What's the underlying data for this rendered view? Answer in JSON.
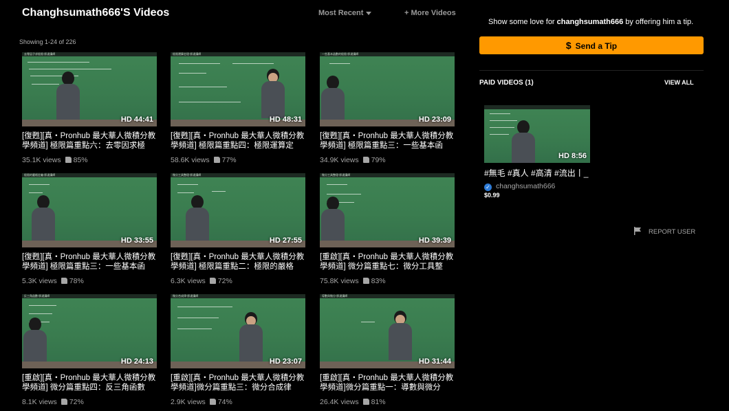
{
  "header": {
    "title": "Changhsumath666'S Videos",
    "sort_label": "Most Recent",
    "more_videos": "+ More Videos",
    "showing": "Showing 1-24 of 226"
  },
  "videos": [
    {
      "title": "[復甦][真・Pronhub 最大華人微積分教學頻道] 極限篇重點六：去零因求極",
      "views": "35.1K views",
      "rating": "85%",
      "duration": "HD 44:41",
      "caption": "去零因子求極限‧胖達講師"
    },
    {
      "title": "[復甦][真・Pronhub 最大華人微積分教學頻道] 極限篇重點四：極限運算定",
      "views": "58.6K views",
      "rating": "77%",
      "duration": "HD 48:31",
      "caption": "極限運算定理‧胖達講師"
    },
    {
      "title": "[復甦][真・Pronhub 最大華人微積分教學頻道] 極限篇重點三：一些基本函",
      "views": "34.9K views",
      "rating": "79%",
      "duration": "HD 23:09",
      "caption": "一些基本函數的極限‧胖達講師"
    },
    {
      "title": "[復甦][真・Pronhub 最大華人微積分教學頻道] 極限篇重點三：一些基本函",
      "views": "5.3K views",
      "rating": "78%",
      "duration": "HD 33:55",
      "caption": "極限的嚴格定義‧胖達講師"
    },
    {
      "title": "[復甦][真・Pronhub 最大華人微積分教學頻道] 極限篇重點二：極限的嚴格",
      "views": "6.3K views",
      "rating": "72%",
      "duration": "HD 27:55",
      "caption": "微分工具整理‧胖達講師"
    },
    {
      "title": "[重啟][真・Pronhub 最大華人微積分教學頻道] 微分篇重點七：微分工具整",
      "views": "75.8K views",
      "rating": "83%",
      "duration": "HD 39:39",
      "caption": "微分工具整理‧胖達講師"
    },
    {
      "title": "[重啟][真・Pronhub 最大華人微積分教學頻道] 微分篇重點四：反三角函數",
      "views": "8.1K views",
      "rating": "72%",
      "duration": "HD 24:13",
      "caption": "反三角函數‧胖達講師"
    },
    {
      "title": "[重啟][真・Pronhub 最大華人微積分教學頻道]微分篇重點三：微分合成律",
      "views": "2.9K views",
      "rating": "74%",
      "duration": "HD 23:07",
      "caption": "微分合成律‧胖達講師"
    },
    {
      "title": "[重啟][真・Pronhub 最大華人微積分教學頻道]微分篇重點一：導數與微分",
      "views": "26.4K views",
      "rating": "81%",
      "duration": "HD 31:44",
      "caption": "導數與微分‧胖達講師"
    }
  ],
  "sidebar": {
    "tip_prefix": "Show some love for ",
    "tip_user": "changhsumath666",
    "tip_suffix": " by offering him a tip.",
    "tip_button": "Send a Tip",
    "paid_title": "PAID VIDEOS (1)",
    "view_all": "VIEW ALL",
    "paid_video": {
      "title": "#無毛 #真人 #高清 #流出丨_",
      "duration": "HD 8:56",
      "user": "changhsumath666",
      "price": "$0.99"
    },
    "report": "REPORT USER"
  },
  "colors": {
    "accent": "#ff9900",
    "board": "#3a7c4f",
    "background": "#000000"
  }
}
